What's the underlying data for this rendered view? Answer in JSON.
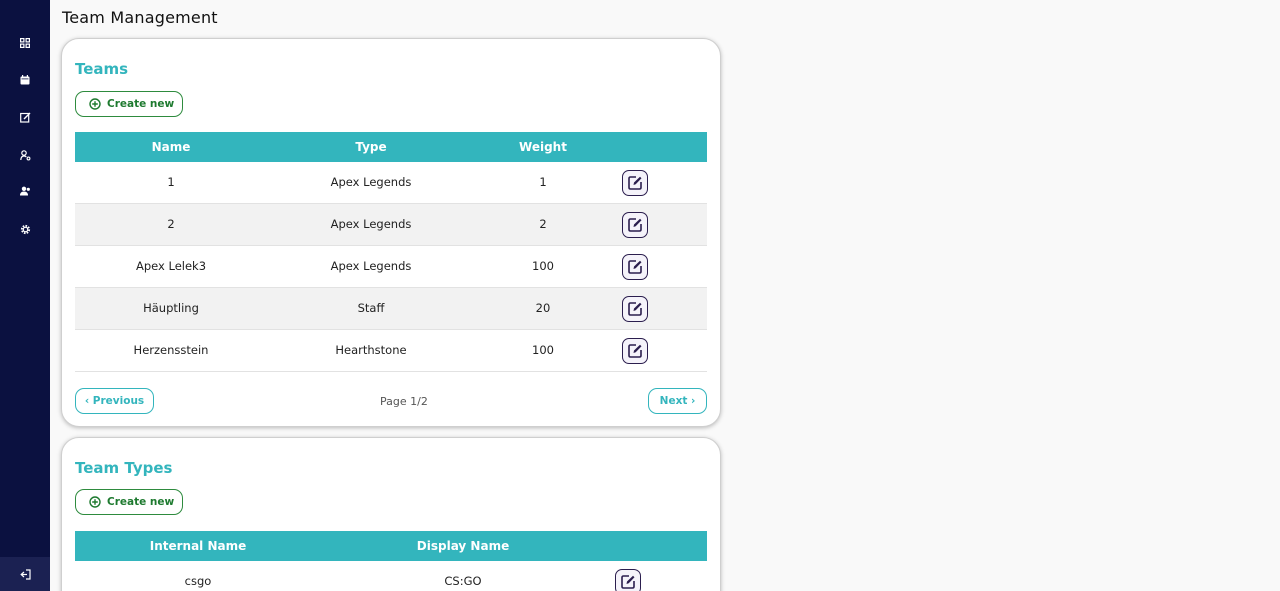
{
  "page": {
    "title": "Team Management"
  },
  "sidebar": {
    "items": [
      {
        "name": "dashboard",
        "icon": "grid-icon"
      },
      {
        "name": "calendar",
        "icon": "calendar-icon"
      },
      {
        "name": "edit",
        "icon": "edit-icon"
      },
      {
        "name": "users",
        "icon": "user-key-icon"
      },
      {
        "name": "teams",
        "icon": "team-icon"
      },
      {
        "name": "settings",
        "icon": "gear-icon"
      }
    ],
    "logout_icon": "logout-icon"
  },
  "teams": {
    "title": "Teams",
    "create_label": "Create new",
    "columns": [
      "Name",
      "Type",
      "Weight"
    ],
    "rows": [
      {
        "name": "1",
        "type": "Apex Legends",
        "weight": "1"
      },
      {
        "name": "2",
        "type": "Apex Legends",
        "weight": "2"
      },
      {
        "name": "Apex Lelek3",
        "type": "Apex Legends",
        "weight": "100"
      },
      {
        "name": "Häuptling",
        "type": "Staff",
        "weight": "20"
      },
      {
        "name": "Herzensstein",
        "type": "Hearthstone",
        "weight": "100"
      }
    ],
    "pagination": {
      "previous": "‹ Previous",
      "next": "Next ›",
      "info": "Page 1/2"
    }
  },
  "team_types": {
    "title": "Team Types",
    "create_label": "Create new",
    "columns": [
      "Internal Name",
      "Display Name"
    ],
    "rows": [
      {
        "internal": "csgo",
        "display": "CS:GO"
      }
    ]
  },
  "colors": {
    "accent": "#33b5bd",
    "sidebar": "#0b1140",
    "create": "#1e7a2f",
    "edit": "#2b1e4e"
  }
}
